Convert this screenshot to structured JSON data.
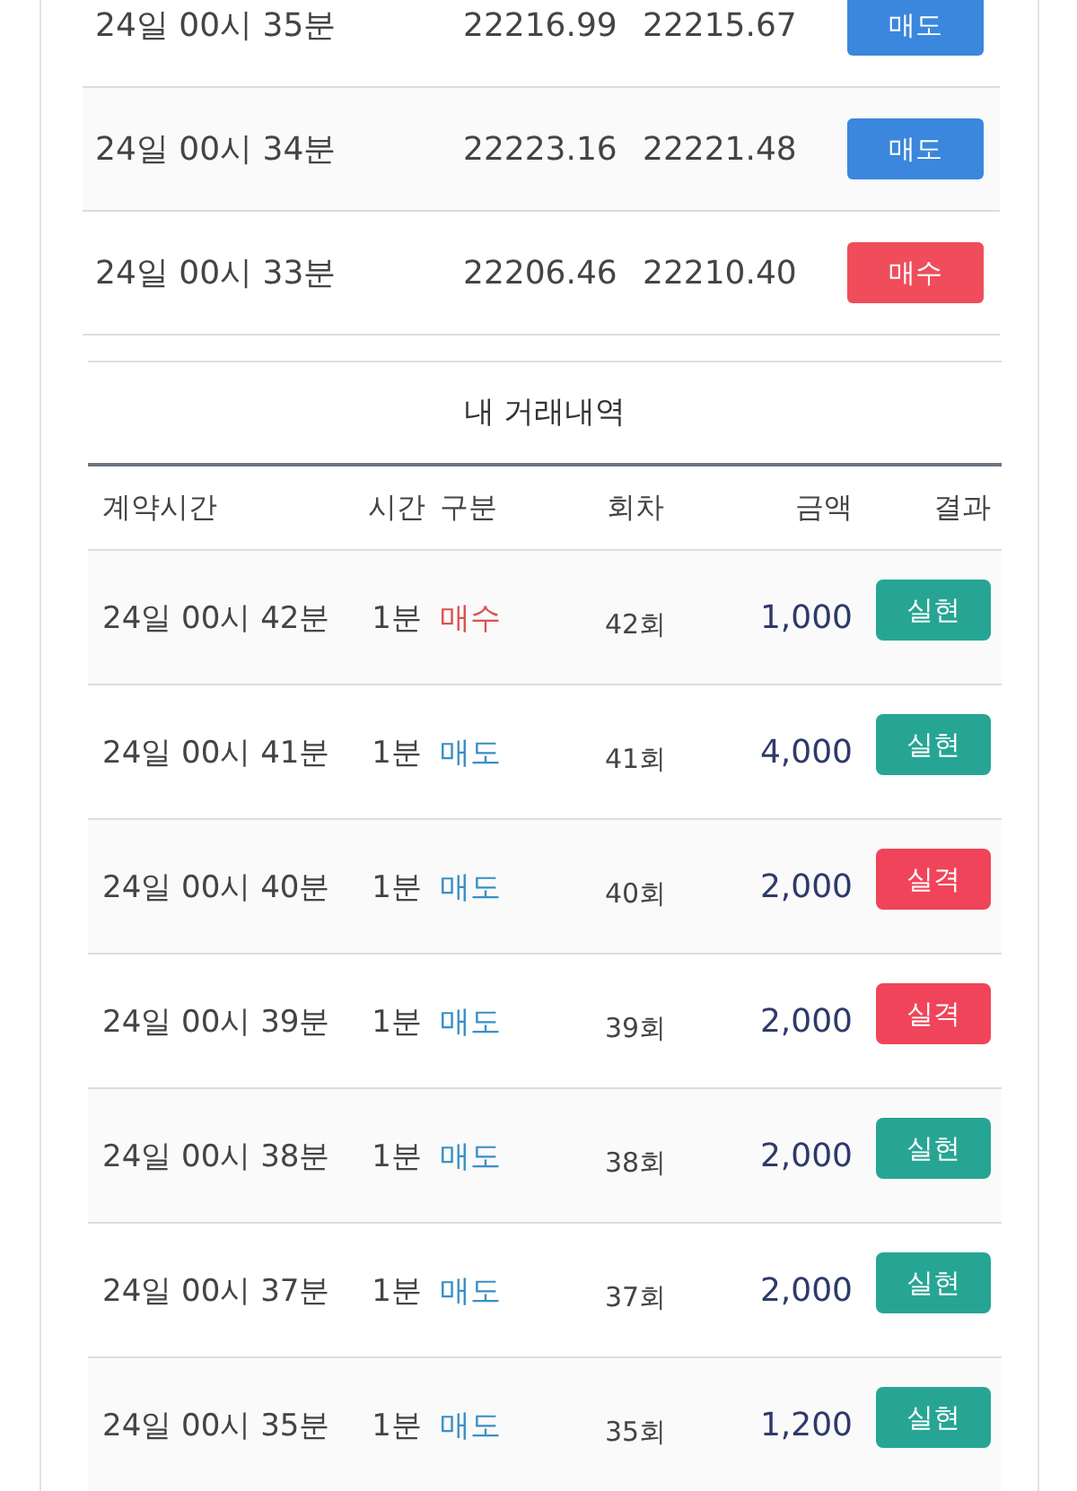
{
  "price_rows": [
    {
      "time": "24일 00시 35분",
      "value_1": "22216.99",
      "value_2": "22215.67",
      "side": {
        "label": "매도",
        "kind": "sell"
      }
    },
    {
      "time": "24일 00시 34분",
      "value_1": "22223.16",
      "value_2": "22221.48",
      "side": {
        "label": "매도",
        "kind": "sell"
      }
    },
    {
      "time": "24일 00시 33분",
      "value_1": "22206.46",
      "value_2": "22210.40",
      "side": {
        "label": "매수",
        "kind": "buy"
      }
    }
  ],
  "history": {
    "title": "내 거래내역",
    "columns": [
      "계약시간",
      "시간",
      "구분",
      "회차",
      "금액",
      "결과"
    ],
    "rows": [
      {
        "contract_time": "24일 00시 42분",
        "duration": "1분",
        "side": {
          "label": "매수",
          "kind": "buy"
        },
        "round": "42회",
        "amount": "1,000",
        "result": {
          "label": "실현",
          "kind": "win"
        }
      },
      {
        "contract_time": "24일 00시 41분",
        "duration": "1분",
        "side": {
          "label": "매도",
          "kind": "sell"
        },
        "round": "41회",
        "amount": "4,000",
        "result": {
          "label": "실현",
          "kind": "win"
        }
      },
      {
        "contract_time": "24일 00시 40분",
        "duration": "1분",
        "side": {
          "label": "매도",
          "kind": "sell"
        },
        "round": "40회",
        "amount": "2,000",
        "result": {
          "label": "실격",
          "kind": "lose"
        }
      },
      {
        "contract_time": "24일 00시 39분",
        "duration": "1분",
        "side": {
          "label": "매도",
          "kind": "sell"
        },
        "round": "39회",
        "amount": "2,000",
        "result": {
          "label": "실격",
          "kind": "lose"
        }
      },
      {
        "contract_time": "24일 00시 38분",
        "duration": "1분",
        "side": {
          "label": "매도",
          "kind": "sell"
        },
        "round": "38회",
        "amount": "2,000",
        "result": {
          "label": "실현",
          "kind": "win"
        }
      },
      {
        "contract_time": "24일 00시 37분",
        "duration": "1분",
        "side": {
          "label": "매도",
          "kind": "sell"
        },
        "round": "37회",
        "amount": "2,000",
        "result": {
          "label": "실현",
          "kind": "win"
        }
      },
      {
        "contract_time": "24일 00시 35분",
        "duration": "1분",
        "side": {
          "label": "매도",
          "kind": "sell"
        },
        "round": "35회",
        "amount": "1,200",
        "result": {
          "label": "실현",
          "kind": "win"
        }
      }
    ]
  }
}
